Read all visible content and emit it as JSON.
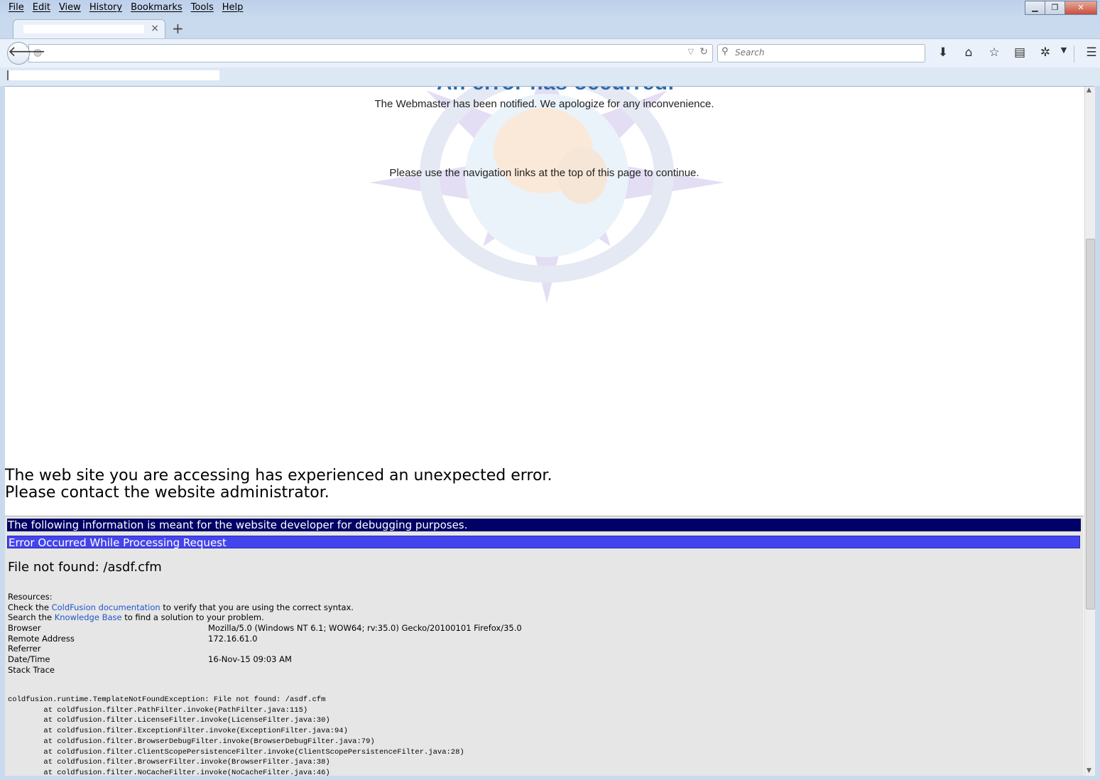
{
  "menu": [
    "File",
    "Edit",
    "View",
    "History",
    "Bookmarks",
    "Tools",
    "Help"
  ],
  "window_controls": {
    "minimize": "▁",
    "restore": "❐",
    "close": "✕"
  },
  "tab": {
    "close": "×",
    "new": "+"
  },
  "search": {
    "placeholder": "Search"
  },
  "page": {
    "heading_cut": "An error has occurred.",
    "notice_notified": "The Webmaster has been notified. We apologize for any inconvenience.",
    "notice_nav": "Please use the navigation links at the top of this page to continue.",
    "error_line1": "The web site you are accessing has experienced an unexpected error.",
    "error_line2": "Please contact the website administrator."
  },
  "debug": {
    "info_bar": "The following information is meant for the website developer for debugging purposes.",
    "error_bar": "Error Occurred While Processing Request",
    "file_not_found": "File not found: /asdf.cfm",
    "resources_label": "Resources:",
    "check_prefix": "Check the ",
    "cf_doc_link": "ColdFusion documentation",
    "check_suffix": " to verify that you are using the correct syntax.",
    "search_prefix": "Search the ",
    "kb_link": "Knowledge Base",
    "search_suffix": " to find a solution to your problem.",
    "fields": [
      {
        "key": "Browser",
        "value": "Mozilla/5.0 (Windows NT 6.1; WOW64; rv:35.0) Gecko/20100101 Firefox/35.0"
      },
      {
        "key": "Remote Address",
        "value": "172.16.61.0"
      },
      {
        "key": "Referrer",
        "value": ""
      },
      {
        "key": "Date/Time",
        "value": "16-Nov-15 09:03 AM"
      },
      {
        "key": "Stack Trace",
        "value": ""
      }
    ],
    "trace": [
      "coldfusion.runtime.TemplateNotFoundException: File not found: /asdf.cfm",
      "        at coldfusion.filter.PathFilter.invoke(PathFilter.java:115)",
      "        at coldfusion.filter.LicenseFilter.invoke(LicenseFilter.java:30)",
      "        at coldfusion.filter.ExceptionFilter.invoke(ExceptionFilter.java:94)",
      "        at coldfusion.filter.BrowserDebugFilter.invoke(BrowserDebugFilter.java:79)",
      "        at coldfusion.filter.ClientScopePersistenceFilter.invoke(ClientScopePersistenceFilter.java:28)",
      "        at coldfusion.filter.BrowserFilter.invoke(BrowserFilter.java:38)",
      "        at coldfusion.filter.NoCacheFilter.invoke(NoCacheFilter.java:46)"
    ]
  },
  "colors": {
    "info_bar": "#000066",
    "error_bar": "#4444ee",
    "link": "#2255cc",
    "heading": "#2d6ca9"
  },
  "icons": [
    "back-icon",
    "globe-icon",
    "dropdown-icon",
    "reload-icon",
    "search-icon",
    "download-icon",
    "home-icon",
    "bookmark-star-icon",
    "reading-list-icon",
    "addon-icon",
    "chevron-down-icon",
    "menu-icon"
  ]
}
